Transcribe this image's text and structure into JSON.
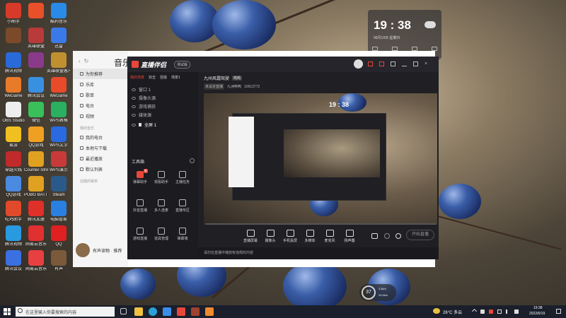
{
  "desktop": {
    "icons": [
      {
        "label": "小刷手"
      },
      {
        "label": ""
      },
      {
        "label": "酷狗音乐"
      },
      {
        "label": ""
      },
      {
        "label": "英雄联盟"
      },
      {
        "label": "迅雷"
      },
      {
        "label": "腾讯视频"
      },
      {
        "label": ""
      },
      {
        "label": "英雄联盟客户端"
      },
      {
        "label": "WeGame"
      },
      {
        "label": "腾讯会议"
      },
      {
        "label": "WeGame"
      },
      {
        "label": "OBS Studio"
      },
      {
        "label": "微信"
      },
      {
        "label": "WPS表格"
      },
      {
        "label": "易游"
      },
      {
        "label": "QQ游戏"
      },
      {
        "label": "WPS文字"
      },
      {
        "label": "穿越火线"
      },
      {
        "label": "Counter-Strike Global"
      },
      {
        "label": "WPS演示"
      },
      {
        "label": "QQ游戏"
      },
      {
        "label": "PUBG BATTLEG."
      },
      {
        "label": "Steam"
      },
      {
        "label": "吃鸡助手"
      },
      {
        "label": "腾讯加速"
      },
      {
        "label": "电脑管家"
      },
      {
        "label": "腾讯视频"
      },
      {
        "label": "网易云音乐"
      },
      {
        "label": "QQ"
      },
      {
        "label": "腾讯会议"
      },
      {
        "label": "网易云音乐"
      },
      {
        "label": "有声"
      }
    ]
  },
  "widget": {
    "time": "19 : 38",
    "date": "06月19日 星期日"
  },
  "music": {
    "title": "音乐",
    "nav": [
      {
        "label": "为你推荐",
        "active": true
      },
      {
        "label": "乐库"
      },
      {
        "label": "歌单"
      },
      {
        "label": "电台"
      },
      {
        "label": "视频"
      }
    ],
    "section_mine": "我的音乐",
    "mine": [
      {
        "label": "我的电台"
      },
      {
        "label": "本地与下载"
      },
      {
        "label": "最近播放"
      },
      {
        "label": "默认列表"
      }
    ],
    "section_created": "创建的歌单",
    "now_playing": "有声读物 · 推荐"
  },
  "live": {
    "app_name": "直播伴侣",
    "version_badge": "测试版",
    "tabs": [
      "我的场景",
      "双击",
      "竖版",
      "场景1"
    ],
    "stream_title": "九州风霜驾驶",
    "stream_tag": "鸡鸡",
    "sub_title": "未设定直播",
    "sub_tag": "九洲鸭鸭",
    "room_id": "10613772",
    "scenes": [
      "窗口 1",
      "摄像头源",
      "游戏捕获",
      "媒体源"
    ],
    "scene_active": "全屏 1",
    "tools_title": "工具箱",
    "tools": [
      {
        "label": "弹幕助手",
        "badge": "新"
      },
      {
        "label": "观看助手"
      },
      {
        "label": "主播任务"
      },
      {
        "label": "抖音直播"
      },
      {
        "label": "多人连麦"
      },
      {
        "label": "直播专区"
      },
      {
        "label": "游戏直播"
      },
      {
        "label": "道具管理"
      },
      {
        "label": "弹幕墙"
      }
    ],
    "bottom_tools": [
      {
        "label": "直播屏幕"
      },
      {
        "label": "摄像头"
      },
      {
        "label": "手机投屏"
      },
      {
        "label": "多媒体"
      },
      {
        "label": "麦克风"
      },
      {
        "label": "扬声器"
      }
    ],
    "preview_time": "19 : 38",
    "start_button": "开始直播",
    "notice": "请勿在直播中播放有违规的内容",
    "fps": "37",
    "net_up": "3.5k/s",
    "net_down": "24.6k/s"
  },
  "taskbar": {
    "search_placeholder": "在这里输入你要搜索的内容",
    "weather": "26°C 多云",
    "time": "19:38",
    "date": "2022/6/19"
  },
  "colors": {
    "accent": "#e8463a",
    "taskbar": "#1a1f2b",
    "live_bg": "#1f1f24"
  }
}
